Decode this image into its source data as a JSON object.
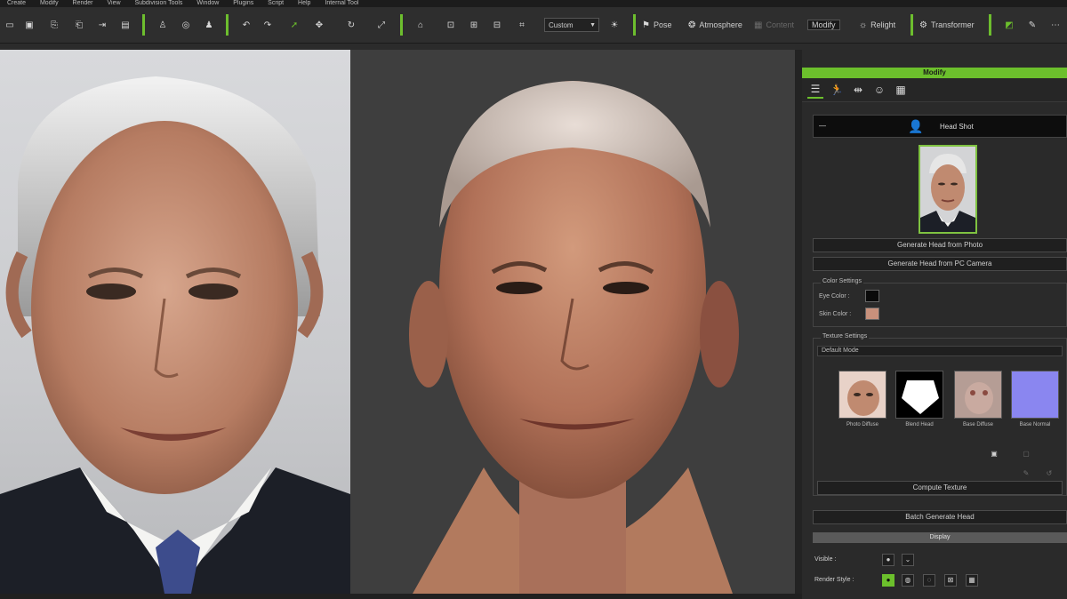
{
  "menu": [
    "Create",
    "Modify",
    "Render",
    "View",
    "Subdivision Tools",
    "Window",
    "Plugins",
    "Script",
    "Help",
    "Internal Tool"
  ],
  "toolbar": {
    "view_combo": "Custom",
    "buttons": {
      "pose": "Pose",
      "atmosphere": "Atmosphere",
      "content": "Content",
      "modify": "Modify",
      "relight": "Relight",
      "transformer": "Transformer"
    }
  },
  "panel": {
    "title": "Modify",
    "headshot_label": "Head Shot",
    "collapse_symbol": "—",
    "generate_from_photo": "Generate Head from Photo",
    "generate_from_camera": "Generate Head from PC Camera",
    "color_settings": {
      "label": "Color Settings",
      "eye_color_label": "Eye Color :",
      "skin_color_label": "Skin Color :",
      "eye_color": "#0a0a0a",
      "skin_color": "#c8917c"
    },
    "texture_settings": {
      "label": "Texture Settings",
      "mode": "Default Mode",
      "items": [
        {
          "label": "Photo Diffuse"
        },
        {
          "label": "Blend Head"
        },
        {
          "label": "Base Diffuse"
        },
        {
          "label": "Base Normal"
        }
      ]
    },
    "compute_texture": "Compute Texture",
    "batch_generate": "Batch Generate Head",
    "display": {
      "label": "Display",
      "visible_label": "Visible :",
      "render_style_label": "Render Style :"
    }
  },
  "colors": {
    "accent": "#6cc02c",
    "panel_bg": "#2a2a2a",
    "toolbar_bg": "#2e2e2e"
  }
}
